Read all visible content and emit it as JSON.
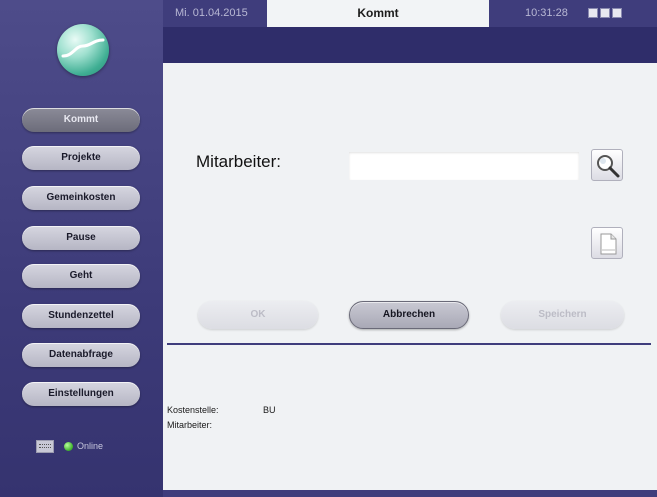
{
  "sidebar": {
    "items": [
      {
        "label": "Kommt",
        "active": true
      },
      {
        "label": "Projekte"
      },
      {
        "label": "Gemeinkosten"
      },
      {
        "label": "Pause"
      },
      {
        "label": "Geht"
      },
      {
        "label": "Stundenzettel"
      },
      {
        "label": "Datenabfrage"
      },
      {
        "label": "Einstellungen"
      }
    ],
    "status": {
      "icon": "keyboard-icon",
      "indicator_color": "#3cb02a",
      "text": "Online"
    }
  },
  "topbar": {
    "date": "Mi. 01.04.2015",
    "title": "Kommt",
    "time": "10:31:28"
  },
  "form": {
    "employee_label": "Mitarbeiter:",
    "employee_value": "",
    "search_icon": "magnifier-icon",
    "doc_icon": "document-icon"
  },
  "actions": {
    "ok": "OK",
    "cancel": "Abbrechen",
    "save": "Speichern"
  },
  "info": {
    "cost_center_label": "Kostenstelle:",
    "cost_center_value": "BU",
    "employee_label": "Mitarbeiter:"
  },
  "colors": {
    "sidebar": "#3f3d7c",
    "accent": "#3f3d7c",
    "main_bg": "#f0f2f4"
  }
}
